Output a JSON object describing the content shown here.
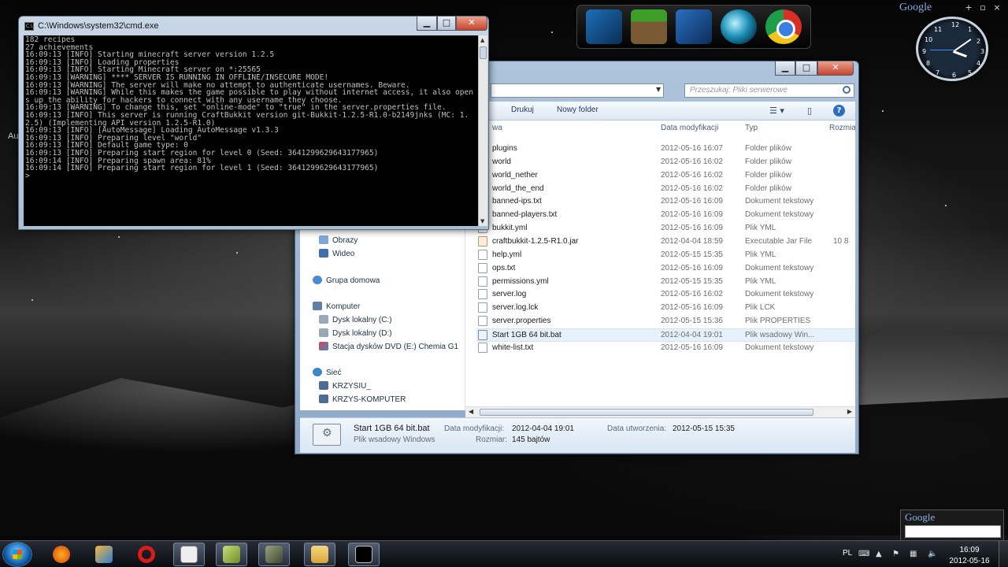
{
  "desktop": {
    "partial_label": "Au"
  },
  "gadgets": {
    "google_top": "Google",
    "google_bottom": "Google",
    "clock_numbers": [
      "12",
      "1",
      "2",
      "3",
      "4",
      "5",
      "6",
      "7",
      "8",
      "9",
      "10",
      "11"
    ]
  },
  "cmd": {
    "title": "C:\\Windows\\system32\\cmd.exe",
    "lines": [
      "182 recipes",
      "27 achievements",
      "16:09:13 [INFO] Starting minecraft server version 1.2.5",
      "16:09:13 [INFO] Loading properties",
      "16:09:13 [INFO] Starting Minecraft server on *:25565",
      "16:09:13 [WARNING] **** SERVER IS RUNNING IN OFFLINE/INSECURE MODE!",
      "16:09:13 [WARNING] The server will make no attempt to authenticate usernames. Beware.",
      "16:09:13 [WARNING] While this makes the game possible to play without internet access, it also opens up the ability for hackers to connect with any username they choose.",
      "16:09:13 [WARNING] To change this, set \"online-mode\" to \"true\" in the server.properties file.",
      "16:09:13 [INFO] This server is running CraftBukkit version git-Bukkit-1.2.5-R1.0-b2149jnks (MC: 1.2.5) (Implementing API version 1.2.5-R1.0)",
      "16:09:13 [INFO] [AutoMessage] Loading AutoMessage v1.3.3",
      "16:09:13 [INFO] Preparing level \"world\"",
      "16:09:13 [INFO] Default game type: 0",
      "16:09:13 [INFO] Preparing start region for level 0 (Seed: 3641299629643177965)",
      "16:09:14 [INFO] Preparing spawn area: 81%",
      "16:09:14 [INFO] Preparing start region for level 1 (Seed: 3641299629643177965)",
      ">"
    ]
  },
  "explorer": {
    "search_placeholder": "Przeszukaj: Pliki serwerowe",
    "toolbar": {
      "print": "Drukuj",
      "new_folder": "Nowy folder"
    },
    "columns": {
      "name": "Nazwa",
      "name_visible": "wa",
      "date": "Data modyfikacji",
      "type": "Typ",
      "size": "Rozmia"
    },
    "nav": [
      {
        "label": "Obrazy",
        "kind": "library"
      },
      {
        "label": "Wideo",
        "kind": "library"
      },
      {
        "label": "Grupa domowa",
        "kind": "homegroup"
      },
      {
        "label": "Komputer",
        "kind": "computer"
      },
      {
        "label": "Dysk lokalny (C:)",
        "kind": "drive"
      },
      {
        "label": "Dysk lokalny (D:)",
        "kind": "drive"
      },
      {
        "label": "Stacja dysków DVD (E:) Chemia G1",
        "kind": "dvd"
      },
      {
        "label": "Sieć",
        "kind": "network"
      },
      {
        "label": "KRZYSIU_",
        "kind": "pc"
      },
      {
        "label": "KRZYS-KOMPUTER",
        "kind": "pc"
      }
    ],
    "files": [
      {
        "name": "plugins",
        "date": "2012-05-16 16:07",
        "type": "Folder plików",
        "size": "",
        "icon": "folder"
      },
      {
        "name": "world",
        "date": "2012-05-16 16:02",
        "type": "Folder plików",
        "size": "",
        "icon": "folder"
      },
      {
        "name": "world_nether",
        "date": "2012-05-16 16:02",
        "type": "Folder plików",
        "size": "",
        "icon": "folder"
      },
      {
        "name": "world_the_end",
        "date": "2012-05-16 16:02",
        "type": "Folder plików",
        "size": "",
        "icon": "folder"
      },
      {
        "name": "banned-ips.txt",
        "date": "2012-05-16 16:09",
        "type": "Dokument tekstowy",
        "size": "",
        "icon": "doc"
      },
      {
        "name": "banned-players.txt",
        "date": "2012-05-16 16:09",
        "type": "Dokument tekstowy",
        "size": "",
        "icon": "doc"
      },
      {
        "name": "bukkit.yml",
        "date": "2012-05-16 16:09",
        "type": "Plik YML",
        "size": "",
        "icon": "doc"
      },
      {
        "name": "craftbukkit-1.2.5-R1.0.jar",
        "date": "2012-04-04 18:59",
        "type": "Executable Jar File",
        "size": "10 8",
        "icon": "jar"
      },
      {
        "name": "help.yml",
        "date": "2012-05-15 15:35",
        "type": "Plik YML",
        "size": "",
        "icon": "doc"
      },
      {
        "name": "ops.txt",
        "date": "2012-05-16 16:09",
        "type": "Dokument tekstowy",
        "size": "",
        "icon": "doc"
      },
      {
        "name": "permissions.yml",
        "date": "2012-05-15 15:35",
        "type": "Plik YML",
        "size": "",
        "icon": "doc"
      },
      {
        "name": "server.log",
        "date": "2012-05-16 16:02",
        "type": "Dokument tekstowy",
        "size": "",
        "icon": "doc"
      },
      {
        "name": "server.log.lck",
        "date": "2012-05-16 16:09",
        "type": "Plik LCK",
        "size": "",
        "icon": "doc"
      },
      {
        "name": "server.properties",
        "date": "2012-05-15 15:36",
        "type": "Plik PROPERTIES",
        "size": "",
        "icon": "doc"
      },
      {
        "name": "Start 1GB 64 bit.bat",
        "date": "2012-04-04 19:01",
        "type": "Plik wsadowy Win...",
        "size": "",
        "icon": "bat",
        "selected": true
      },
      {
        "name": "white-list.txt",
        "date": "2012-05-16 16:09",
        "type": "Dokument tekstowy",
        "size": "",
        "icon": "doc"
      }
    ],
    "details": {
      "filename": "Start 1GB 64 bit.bat",
      "filetype": "Plik wsadowy Windows",
      "mod_label": "Data modyfikacji:",
      "mod_value": "2012-04-04 19:01",
      "size_label": "Rozmiar:",
      "size_value": "145 bajtów",
      "created_label": "Data utworzenia:",
      "created_value": "2012-05-15 15:35"
    }
  },
  "taskbar": {
    "language": "PL",
    "time": "16:09",
    "date": "2012-05-16"
  }
}
